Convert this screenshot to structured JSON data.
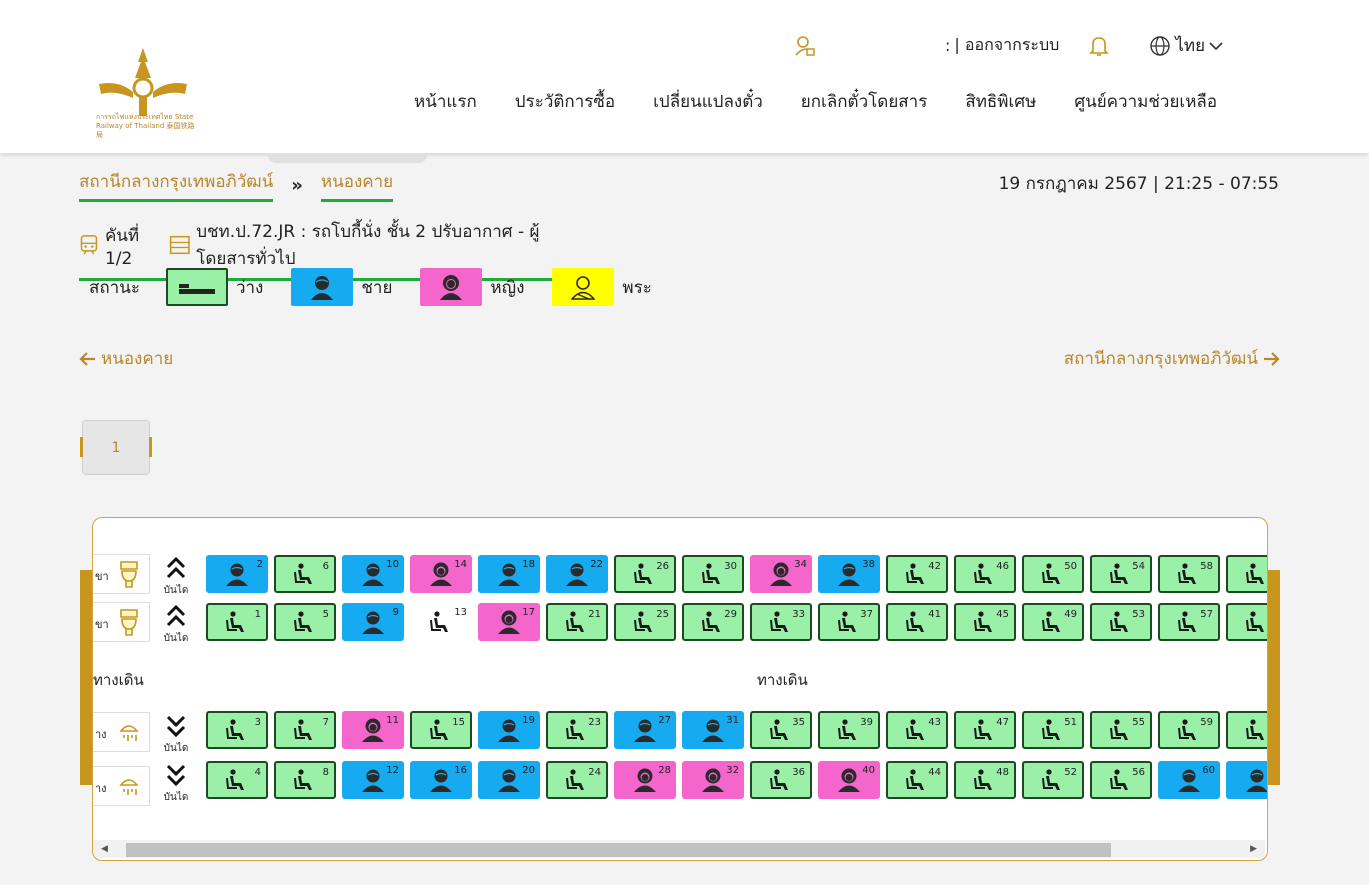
{
  "header": {
    "logo_text": "การรถไฟแห่งประเทศไทย State Railway of Thailand 泰国铁路局",
    "user_sep": ":",
    "logout": "| ออกจากระบบ",
    "language": "ไทย",
    "nav": [
      "หน้าแรก",
      "ประวัติการซื้อ",
      "เปลี่ยนแปลงตั๋ว",
      "ยกเลิกตั๋วโดยสาร",
      "สิทธิพิเศษ",
      "ศูนย์ความช่วยเหลือ"
    ]
  },
  "route": {
    "from": "สถานีกลางกรุงเทพอภิวัฒน์",
    "arrows": "»",
    "to": "หนองคาย",
    "datetime": "19 กรกฎาคม 2567 | 21:25 - 07:55"
  },
  "car": {
    "index": "คันที่ 1/2",
    "description": "บชท.ป.72.JR : รถโบกี้นั่ง ชั้น 2 ปรับอากาศ - ผู้โดยสารทั่วไป"
  },
  "legend": {
    "title": "สถานะ",
    "items": [
      {
        "label": "ว่าง",
        "type": "free"
      },
      {
        "label": "ชาย",
        "type": "male"
      },
      {
        "label": "หญิง",
        "type": "female"
      },
      {
        "label": "พระ",
        "type": "monk"
      }
    ],
    "colors": {
      "free": "#9bf0a8",
      "male": "#16aaf0",
      "female": "#f466cc",
      "monk": "#ffff00",
      "selected": "#18f0f0"
    }
  },
  "direction": {
    "left": "หนองคาย",
    "right": "สถานีกลางกรุงเทพอภิวัฒน์"
  },
  "page": {
    "current": "1"
  },
  "coach": {
    "facility_top": [
      "ขา",
      "ขา"
    ],
    "facility_bottom": [
      "าง",
      "าง"
    ],
    "stair_label": "บันได",
    "aisle_left": "ทางเดิน",
    "aisle_center": "ทางเดิน",
    "rows": [
      [
        [
          "2",
          "male"
        ],
        [
          "6",
          "free"
        ],
        [
          "10",
          "male"
        ],
        [
          "14",
          "female"
        ],
        [
          "18",
          "male"
        ],
        [
          "22",
          "male"
        ],
        [
          "26",
          "free"
        ],
        [
          "30",
          "free"
        ],
        [
          "34",
          "female"
        ],
        [
          "38",
          "male"
        ],
        [
          "42",
          "free"
        ],
        [
          "46",
          "free"
        ],
        [
          "50",
          "free"
        ],
        [
          "54",
          "free"
        ],
        [
          "58",
          "free"
        ],
        [
          "",
          "free"
        ]
      ],
      [
        [
          "1",
          "free"
        ],
        [
          "5",
          "free"
        ],
        [
          "9",
          "male"
        ],
        [
          "13",
          "selected"
        ],
        [
          "17",
          "female"
        ],
        [
          "21",
          "free"
        ],
        [
          "25",
          "free"
        ],
        [
          "29",
          "free"
        ],
        [
          "33",
          "free"
        ],
        [
          "37",
          "free"
        ],
        [
          "41",
          "free"
        ],
        [
          "45",
          "free"
        ],
        [
          "49",
          "free"
        ],
        [
          "53",
          "free"
        ],
        [
          "57",
          "free"
        ],
        [
          "",
          "free"
        ]
      ],
      [
        [
          "3",
          "free"
        ],
        [
          "7",
          "free"
        ],
        [
          "11",
          "female"
        ],
        [
          "15",
          "free"
        ],
        [
          "19",
          "male"
        ],
        [
          "23",
          "free"
        ],
        [
          "27",
          "male"
        ],
        [
          "31",
          "male"
        ],
        [
          "35",
          "free"
        ],
        [
          "39",
          "free"
        ],
        [
          "43",
          "free"
        ],
        [
          "47",
          "free"
        ],
        [
          "51",
          "free"
        ],
        [
          "55",
          "free"
        ],
        [
          "59",
          "free"
        ],
        [
          "",
          "free"
        ]
      ],
      [
        [
          "4",
          "free"
        ],
        [
          "8",
          "free"
        ],
        [
          "12",
          "male"
        ],
        [
          "16",
          "male"
        ],
        [
          "20",
          "male"
        ],
        [
          "24",
          "free"
        ],
        [
          "28",
          "female"
        ],
        [
          "32",
          "female"
        ],
        [
          "36",
          "free"
        ],
        [
          "40",
          "female"
        ],
        [
          "44",
          "free"
        ],
        [
          "48",
          "free"
        ],
        [
          "52",
          "free"
        ],
        [
          "56",
          "free"
        ],
        [
          "60",
          "male"
        ],
        [
          "",
          "male"
        ]
      ]
    ]
  }
}
